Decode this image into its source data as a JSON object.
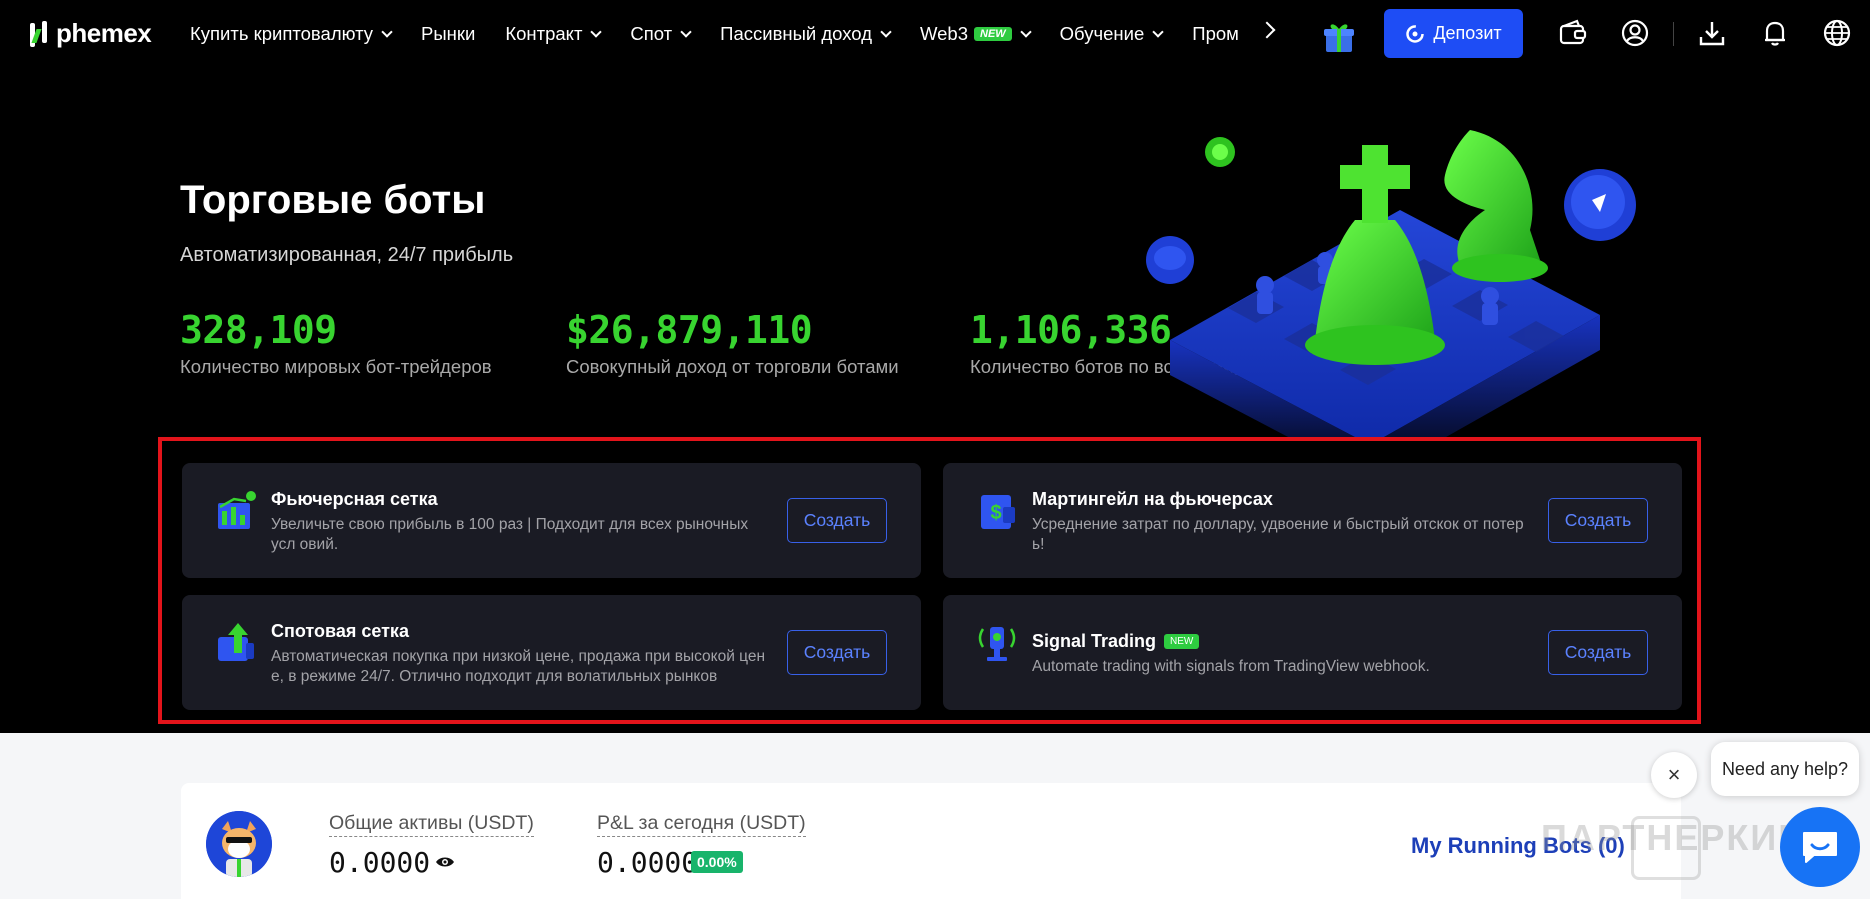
{
  "brand": {
    "name": "phemex"
  },
  "nav": {
    "items": [
      {
        "label": "Купить криптовалюту",
        "dropdown": true
      },
      {
        "label": "Рынки",
        "dropdown": false
      },
      {
        "label": "Контракт",
        "dropdown": true
      },
      {
        "label": "Спот",
        "dropdown": true
      },
      {
        "label": "Пассивный доход",
        "dropdown": true
      },
      {
        "label": "Web3",
        "badge": "NEW",
        "dropdown": true
      },
      {
        "label": "Обучение",
        "dropdown": true
      },
      {
        "label": "Пром",
        "dropdown": false
      }
    ],
    "deposit_label": "Депозит",
    "icons": [
      "gift-icon",
      "wallet-icon",
      "profile-icon",
      "download-icon",
      "bell-icon",
      "globe-icon"
    ]
  },
  "hero": {
    "title": "Торговые боты",
    "subtitle": "Автоматизированная, 24/7 прибыль",
    "stats": [
      {
        "value": "328,109",
        "label": "Количество мировых бот-трейдеров"
      },
      {
        "value": "$26,879,110",
        "label": "Совокупный доход от торговли ботами"
      },
      {
        "value": "1,106,336",
        "label": "Количество ботов по всему миру"
      }
    ]
  },
  "bots": [
    {
      "title": "Фьючерсная сетка",
      "desc": "Увеличьте свою прибыль в 100 раз | Подходит для всех рыночных усл овий.",
      "button": "Создать",
      "icon": "futures-grid-icon"
    },
    {
      "title": "Мартингейл на фьючерсах",
      "desc": "Усреднение затрат по доллару, удвоение и быстрый отскок от потер ь!",
      "button": "Создать",
      "icon": "martingale-icon"
    },
    {
      "title": "Спотовая сетка",
      "desc": "Автоматическая покупка при низкой цене, продажа при высокой цен е, в режиме 24/7. Отлично подходит для волатильных рынков",
      "button": "Создать",
      "icon": "spot-grid-icon"
    },
    {
      "title": "Signal Trading",
      "badge": "NEW",
      "desc": "Automate trading with signals from TradingView webhook.",
      "button": "Создать",
      "icon": "signal-icon"
    }
  ],
  "account": {
    "total_assets_label": "Общие активы (USDT)",
    "total_assets_value": "0.0000",
    "pnl_label": "P&L за сегодня (USDT)",
    "pnl_value": "0.0000",
    "pnl_percent": "0.00%",
    "running_bots": "My Running Bots (0)"
  },
  "watermark": "ПАРТНЕРКИН",
  "help": {
    "text": "Need any help?",
    "close": "×"
  },
  "colors": {
    "accent": "#1e4df5",
    "green": "#38d430",
    "highlight": "#e3141b"
  }
}
